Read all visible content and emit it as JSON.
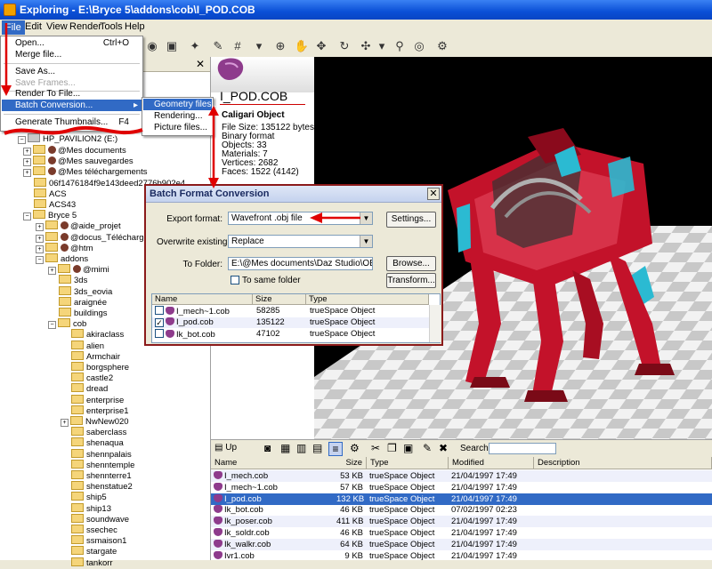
{
  "window": {
    "title": "Exploring - E:\\Bryce 5\\addons\\cob\\I_POD.COB"
  },
  "menubar": [
    "File",
    "Edit",
    "View",
    "Render",
    "Tools",
    "Help"
  ],
  "file_menu": {
    "items": [
      {
        "label": "Open...",
        "shortcut": "Ctrl+O"
      },
      {
        "label": "Merge file..."
      },
      {
        "label": "Save As..."
      },
      {
        "label": "Save Frames...",
        "disabled": true
      },
      {
        "label": "Render To File..."
      },
      {
        "label": "Batch Conversion...",
        "submenu": true
      },
      {
        "label": "Generate Thumbnails...",
        "shortcut": "F4"
      }
    ],
    "submenu": [
      "Geometry files...",
      "Rendering...",
      "Picture files..."
    ]
  },
  "tree": {
    "drive": "HP_PAVILION2 (E:)",
    "items": [
      "@Mes documents",
      "@Mes sauvegardes",
      "@Mes téléchargements",
      "06f1476184f9e143deed2776b902e4",
      "ACS",
      "ACS43",
      "Bryce 5",
      "@aide_projet",
      "@docus_Téléchargés",
      "@htm",
      "addons",
      "@mimi",
      "3ds",
      "3ds_eovia",
      "araignée",
      "buildings",
      "cob",
      "akiraclass",
      "alien",
      "Armchair",
      "borgsphere",
      "castle2",
      "dread",
      "enterprise",
      "enterprise1",
      "NwNew020",
      "saberclass",
      "shenaqua",
      "shennpalais",
      "shenntemple",
      "shennterre1",
      "shenstatue2",
      "ship5",
      "ship13",
      "soundwave",
      "ssechec",
      "ssmaison1",
      "stargate",
      "tankorr"
    ]
  },
  "preview": {
    "filename": "I_POD.COB",
    "type": "Caligari Object",
    "lines": [
      "File Size: 135122 bytes",
      "Binary format",
      "Objects:  33",
      "Materials: 7",
      "Vertices:  2682",
      "Faces:     1522 (4142)"
    ]
  },
  "dialog": {
    "title": "Batch Format Conversion",
    "export_label": "Export format:",
    "export_value": "Wavefront .obj file",
    "overwrite_label": "Overwrite existing:",
    "overwrite_value": "Replace",
    "folder_label": "To Folder:",
    "folder_value": "E:\\@Mes documents\\Daz Studio\\OBJ\\obj_",
    "same_folder_label": "To same folder",
    "buttons": {
      "settings": "Settings...",
      "browse": "Browse...",
      "transform": "Transform..."
    },
    "columns": [
      "Name",
      "Size",
      "Type"
    ],
    "rows": [
      {
        "name": "I_mech~1.cob",
        "size": "58285",
        "type": "trueSpace Object",
        "checked": false
      },
      {
        "name": "I_pod.cob",
        "size": "135122",
        "type": "trueSpace Object",
        "checked": true
      },
      {
        "name": "Ik_bot.cob",
        "size": "47102",
        "type": "trueSpace Object",
        "checked": false
      }
    ]
  },
  "list_toolbar": {
    "up_label": "Up",
    "search_label": "Search:"
  },
  "file_list": {
    "columns": [
      "Name",
      "Size",
      "Type",
      "Modified",
      "Description"
    ],
    "rows": [
      {
        "name": "I_mech.cob",
        "size": "53 KB",
        "type": "trueSpace Object",
        "modified": "21/04/1997 17:49"
      },
      {
        "name": "I_mech~1.cob",
        "size": "57 KB",
        "type": "trueSpace Object",
        "modified": "21/04/1997 17:49"
      },
      {
        "name": "I_pod.cob",
        "size": "132 KB",
        "type": "trueSpace Object",
        "modified": "21/04/1997 17:49",
        "selected": true
      },
      {
        "name": "Ik_bot.cob",
        "size": "46 KB",
        "type": "trueSpace Object",
        "modified": "07/02/1997 02:23"
      },
      {
        "name": "Ik_poser.cob",
        "size": "411 KB",
        "type": "trueSpace Object",
        "modified": "21/04/1997 17:49"
      },
      {
        "name": "Ik_soldr.cob",
        "size": "46 KB",
        "type": "trueSpace Object",
        "modified": "21/04/1997 17:49"
      },
      {
        "name": "Ik_walkr.cob",
        "size": "64 KB",
        "type": "trueSpace Object",
        "modified": "21/04/1997 17:49"
      },
      {
        "name": "Ivr1.cob",
        "size": "9 KB",
        "type": "trueSpace Object",
        "modified": "21/04/1997 17:49"
      }
    ]
  },
  "colors": {
    "accent": "#316ac5",
    "annotation": "#e00000",
    "title_bar": "#0a4fd6"
  }
}
